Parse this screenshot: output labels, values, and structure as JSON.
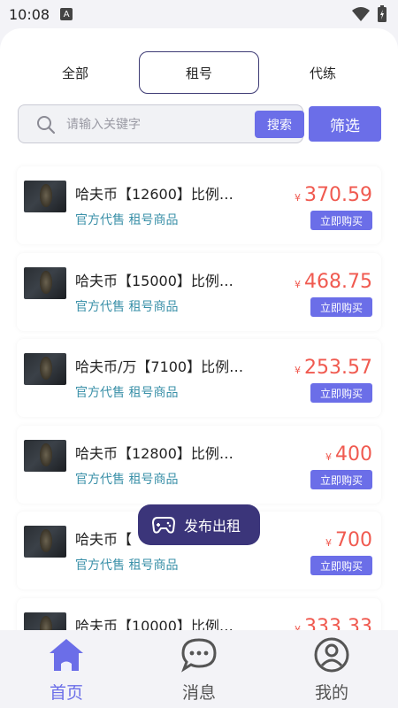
{
  "status_bar": {
    "time": "10:08",
    "indicator": "A"
  },
  "tabs": [
    {
      "label": "全部",
      "active": false
    },
    {
      "label": "租号",
      "active": true
    },
    {
      "label": "代练",
      "active": false
    }
  ],
  "search": {
    "placeholder": "请输入关键字",
    "button_label": "搜索"
  },
  "filter_label": "筛选",
  "items": [
    {
      "title": "哈夫币【12600】比例…",
      "tags": "官方代售 租号商品",
      "currency": "¥",
      "price": "370.59",
      "buy_label": "立即购买"
    },
    {
      "title": "哈夫币【15000】比例…",
      "tags": "官方代售 租号商品",
      "currency": "¥",
      "price": "468.75",
      "buy_label": "立即购买"
    },
    {
      "title": "哈夫币/万【7100】比例…",
      "tags": "官方代售 租号商品",
      "currency": "¥",
      "price": "253.57",
      "buy_label": "立即购买"
    },
    {
      "title": "哈夫币【12800】比例…",
      "tags": "官方代售 租号商品",
      "currency": "¥",
      "price": "400",
      "buy_label": "立即购买"
    },
    {
      "title": "哈夫币【",
      "tags": "官方代售 租号商品",
      "currency": "¥",
      "price": "700",
      "buy_label": "立即购买"
    },
    {
      "title": "哈夫币【10000】比例…",
      "tags": "",
      "currency": "¥",
      "price": "333.33",
      "buy_label": ""
    }
  ],
  "publish_button": {
    "label": "发布出租",
    "icon": "gamepad-icon"
  },
  "bottom_nav": [
    {
      "label": "首页",
      "icon": "home-icon",
      "active": true
    },
    {
      "label": "消息",
      "icon": "chat-icon",
      "active": false
    },
    {
      "label": "我的",
      "icon": "user-icon",
      "active": false
    }
  ],
  "colors": {
    "accent": "#6b6ee8",
    "price": "#f05a50",
    "tag": "#3a90a8",
    "publish_bg": "#3b357a"
  }
}
